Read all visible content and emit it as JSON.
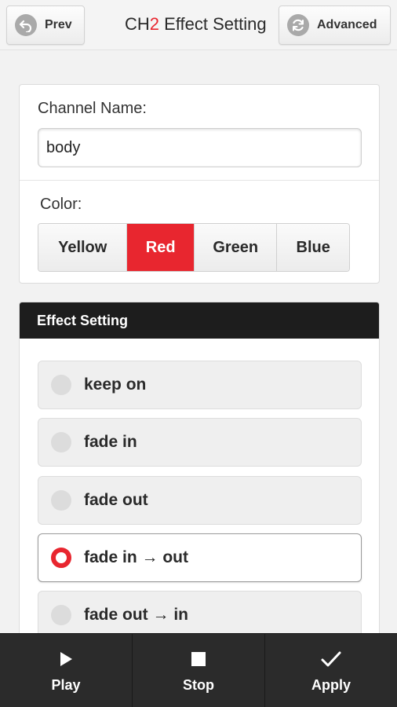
{
  "header": {
    "prev_label": "Prev",
    "title_prefix": "CH",
    "title_number": "2",
    "title_suffix": " Effect Setting",
    "advanced_label": "Advanced",
    "prev_icon": "back-arrow-icon",
    "advanced_icon": "refresh-icon"
  },
  "channel": {
    "name_label": "Channel Name:",
    "name_value": "body",
    "color_label": "Color:",
    "colors": [
      "Yellow",
      "Red",
      "Green",
      "Blue"
    ],
    "selected_color": "Red"
  },
  "effect": {
    "heading": "Effect Setting",
    "options": [
      "keep on",
      "fade in",
      "fade out",
      "fade in → out",
      "fade out → in"
    ],
    "selected": "fade in → out"
  },
  "bottombar": {
    "play_label": "Play",
    "stop_label": "Stop",
    "apply_label": "Apply",
    "play_icon": "play-icon",
    "stop_icon": "stop-icon",
    "apply_icon": "checkmark-icon"
  },
  "colors": {
    "accent": "#e8262f",
    "header_dark": "#1d1d1d",
    "bottombar": "#2b2b2b"
  }
}
